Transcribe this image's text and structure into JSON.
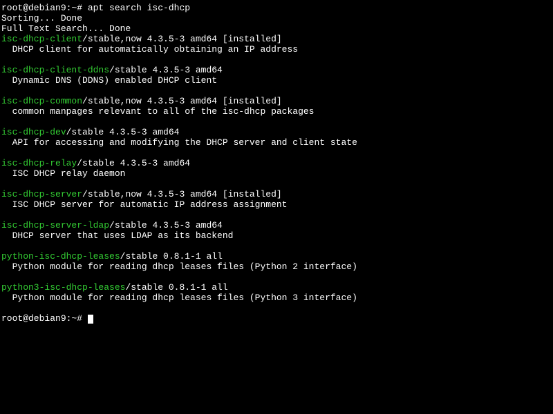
{
  "prompt1": "root@debian9:~# apt search isc-dhcp",
  "sorting": "Sorting... Done",
  "searching": "Full Text Search... Done",
  "packages": [
    {
      "name": "isc-dhcp-client",
      "info": "/stable,now 4.3.5-3 amd64 [installed]",
      "desc": "  DHCP client for automatically obtaining an IP address"
    },
    {
      "name": "isc-dhcp-client-ddns",
      "info": "/stable 4.3.5-3 amd64",
      "desc": "  Dynamic DNS (DDNS) enabled DHCP client"
    },
    {
      "name": "isc-dhcp-common",
      "info": "/stable,now 4.3.5-3 amd64 [installed]",
      "desc": "  common manpages relevant to all of the isc-dhcp packages"
    },
    {
      "name": "isc-dhcp-dev",
      "info": "/stable 4.3.5-3 amd64",
      "desc": "  API for accessing and modifying the DHCP server and client state"
    },
    {
      "name": "isc-dhcp-relay",
      "info": "/stable 4.3.5-3 amd64",
      "desc": "  ISC DHCP relay daemon"
    },
    {
      "name": "isc-dhcp-server",
      "info": "/stable,now 4.3.5-3 amd64 [installed]",
      "desc": "  ISC DHCP server for automatic IP address assignment"
    },
    {
      "name": "isc-dhcp-server-ldap",
      "info": "/stable 4.3.5-3 amd64",
      "desc": "  DHCP server that uses LDAP as its backend"
    },
    {
      "name": "python-isc-dhcp-leases",
      "info": "/stable 0.8.1-1 all",
      "desc": "  Python module for reading dhcp leases files (Python 2 interface)"
    },
    {
      "name": "python3-isc-dhcp-leases",
      "info": "/stable 0.8.1-1 all",
      "desc": "  Python module for reading dhcp leases files (Python 3 interface)"
    }
  ],
  "prompt2": "root@debian9:~# "
}
